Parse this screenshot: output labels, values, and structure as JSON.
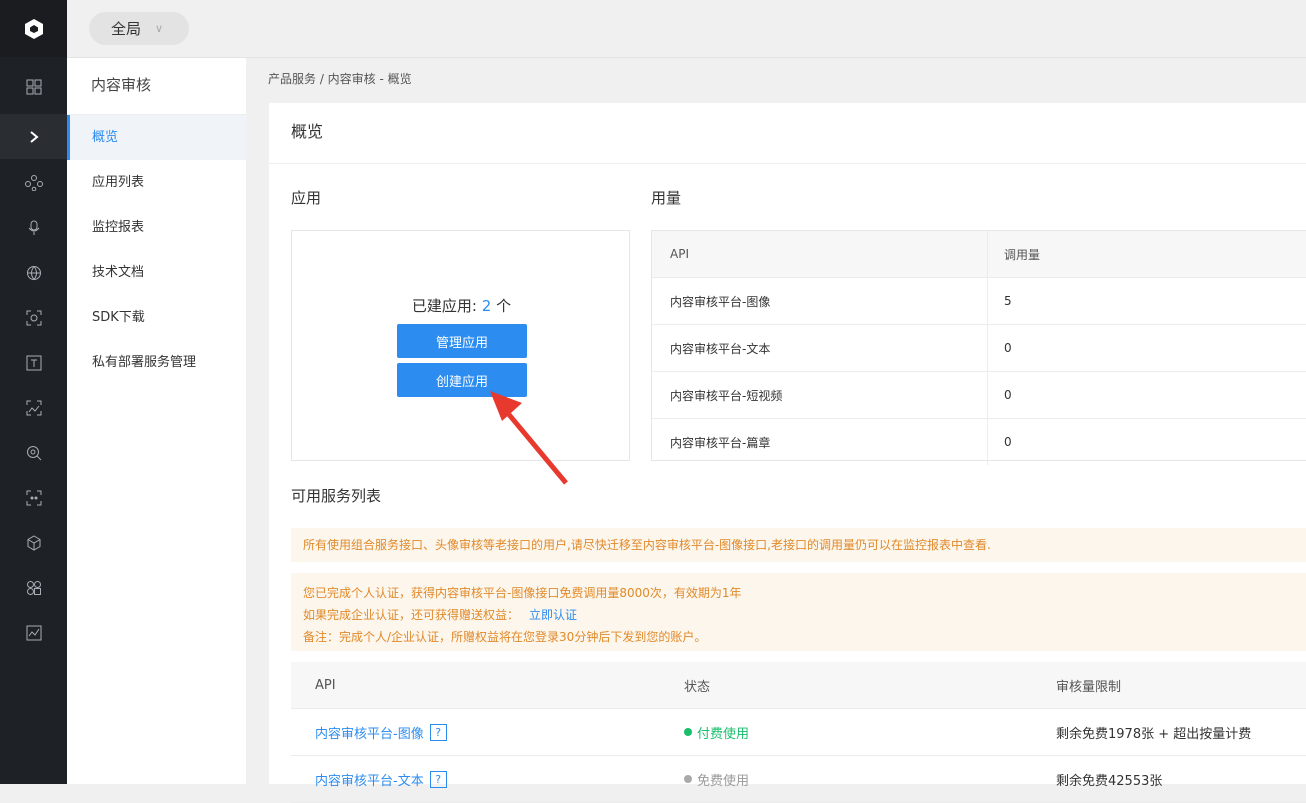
{
  "topbar": {
    "scope_label": "全局"
  },
  "rail": {
    "icons": [
      "grid-icon",
      "expand-icon",
      "network-icon",
      "mic-icon",
      "globe-icon",
      "face-scan-icon",
      "text-icon",
      "image-recog-icon",
      "search-face-icon",
      "image-analysis-icon",
      "cube-icon",
      "apps-icon",
      "chart-icon"
    ]
  },
  "subnav": {
    "title": "内容审核",
    "items": [
      {
        "label": "概览",
        "active": true
      },
      {
        "label": "应用列表"
      },
      {
        "label": "监控报表"
      },
      {
        "label": "技术文档"
      },
      {
        "label": "SDK下载"
      },
      {
        "label": "私有部署服务管理"
      }
    ]
  },
  "breadcrumb": "产品服务 / 内容审核 - 概览",
  "main": {
    "title": "概览",
    "apps": {
      "section_title": "应用",
      "built_prefix": "已建应用: ",
      "built_count": "2",
      "built_suffix": " 个",
      "manage_button": "管理应用",
      "create_button": "创建应用"
    },
    "usage": {
      "section_title": "用量",
      "headers": [
        "API",
        "调用量"
      ],
      "rows": [
        {
          "api": "内容审核平台-图像",
          "count": "5"
        },
        {
          "api": "内容审核平台-文本",
          "count": "0"
        },
        {
          "api": "内容审核平台-短视频",
          "count": "0"
        },
        {
          "api": "内容审核平台-篇章",
          "count": "0"
        }
      ]
    },
    "services": {
      "section_title": "可用服务列表",
      "notice1": "所有使用组合服务接口、头像审核等老接口的用户,请尽快迁移至内容审核平台-图像接口,老接口的调用量仍可以在监控报表中查看.",
      "notice2_line1": "您已完成个人认证，获得内容审核平台-图像接口免费调用量8000次，有效期为1年",
      "notice2_line2": "如果完成企业认证，还可获得赠送权益：",
      "notice2_link": "立即认证",
      "notice2_line3": "备注：完成个人/企业认证，所赠权益将在您登录30分钟后下发到您的账户。",
      "headers": [
        "API",
        "状态",
        "审核量限制"
      ],
      "rows": [
        {
          "api": "内容审核平台-图像",
          "help": "?",
          "status": "付费使用",
          "status_color": "#19be6b",
          "limit": "剩余免费1978张 + 超出按量计费"
        },
        {
          "api": "内容审核平台-文本",
          "help": "?",
          "status": "免费使用",
          "status_color": "#999999",
          "limit": "剩余免费42553张"
        }
      ]
    }
  },
  "colors": {
    "accent": "#2d8cf0",
    "rail_bg": "#1e2125",
    "notice_text": "#e08a2a",
    "annotation_arrow": "#e8392e"
  }
}
